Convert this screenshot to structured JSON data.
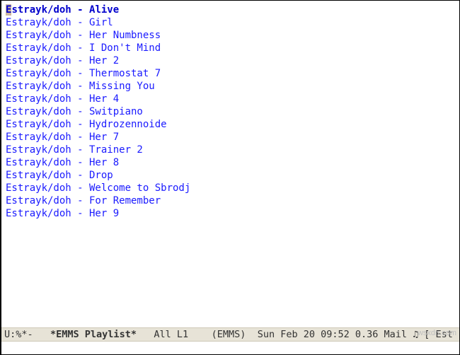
{
  "playlist": {
    "tracks": [
      "Estrayk/doh - Alive",
      "Estrayk/doh - Girl",
      "Estrayk/doh - Her Numbness",
      "Estrayk/doh - I Don't Mind",
      "Estrayk/doh - Her 2",
      "Estrayk/doh - Thermostat 7",
      "Estrayk/doh - Missing You",
      "Estrayk/doh - Her 4",
      "Estrayk/doh - Switpiano",
      "Estrayk/doh - Hydrozennoide",
      "Estrayk/doh - Her 7",
      "Estrayk/doh - Trainer 2",
      "Estrayk/doh - Her 8",
      "Estrayk/doh - Drop",
      "Estrayk/doh - Welcome to Sbrodj",
      "Estrayk/doh - For Remember",
      "Estrayk/doh - Her 9"
    ],
    "current_index": 0
  },
  "modeline": {
    "left": "U:%*-",
    "buffer_name": "*EMMS Playlist*",
    "position": "All L1",
    "mode": "(EMMS)",
    "time": "Sun Feb 20 09:52",
    "load": "0.36",
    "mail": "Mail",
    "music_icon": "♫",
    "bracket": "[",
    "tail": "Est"
  },
  "watermark": "wsxdn.com"
}
